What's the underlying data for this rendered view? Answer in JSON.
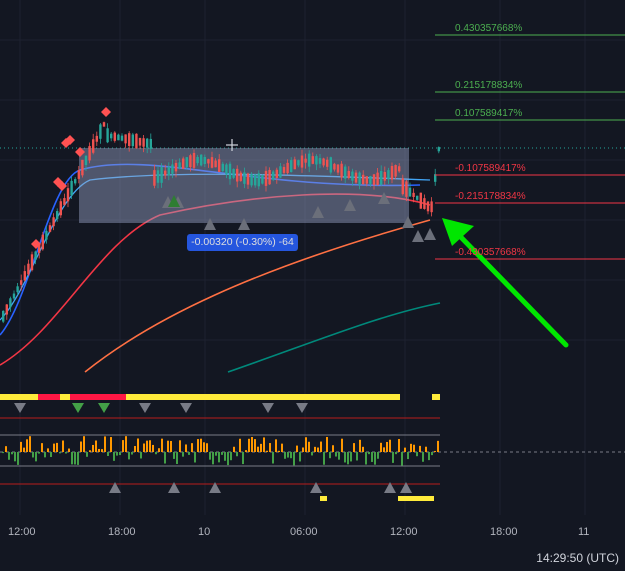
{
  "fib_levels": [
    {
      "label": "0.430357668%",
      "color": "#4caf50"
    },
    {
      "label": "0.215178834%",
      "color": "#4caf50"
    },
    {
      "label": "0.107589417%",
      "color": "#4caf50"
    },
    {
      "label": "-0.107589417%",
      "color": "#f23645"
    },
    {
      "label": "-0.215178834%",
      "color": "#f23645"
    },
    {
      "label": "-0.430357668%",
      "color": "#f23645"
    }
  ],
  "measure_tooltip": "-0.00320 (-0.30%) -64",
  "time_axis": [
    "12:00",
    "18:00",
    "10",
    "06:00",
    "12:00",
    "18:00",
    "11"
  ],
  "clock": "14:29:50 (UTC)",
  "colors": {
    "background": "#131722",
    "up_candle": "#26a69a",
    "down_candle": "#ef5350",
    "ema_fast": "#2962ff",
    "ema_mid": "#f23645",
    "ema_slow": "#ff7043",
    "ema_long": "#00897b",
    "arrow": "#00e600",
    "signal_bar_yellow": "#ffeb3b",
    "signal_bar_red": "#ff1744",
    "histogram_orange": "#ff9800",
    "histogram_green": "#43a047"
  },
  "icons": [
    "crosshair-icon",
    "diamond-marker-icon",
    "triangle-marker-icon",
    "green-arrow-icon"
  ]
}
